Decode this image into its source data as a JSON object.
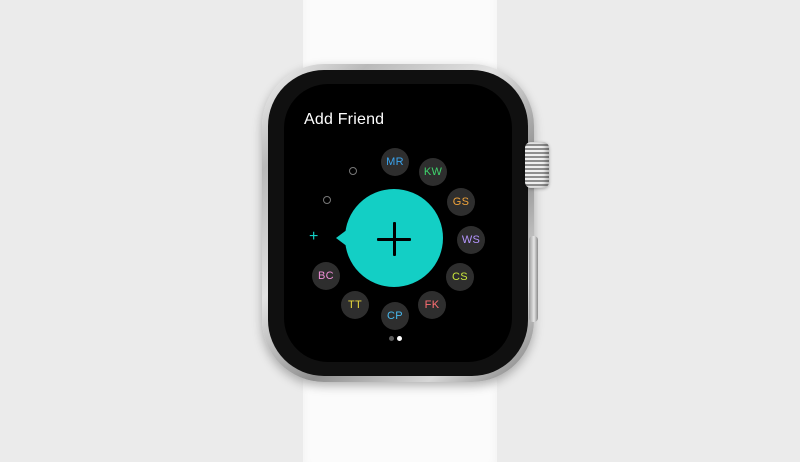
{
  "screen": {
    "title": "Add Friend"
  },
  "friends": [
    {
      "initials": "MR",
      "color": "#3aa5f0"
    },
    {
      "initials": "KW",
      "color": "#3fd46c"
    },
    {
      "initials": "GS",
      "color": "#f1a43a"
    },
    {
      "initials": "WS",
      "color": "#b596ff"
    },
    {
      "initials": "CS",
      "color": "#c9e63c"
    },
    {
      "initials": "FK",
      "color": "#ff6f73"
    },
    {
      "initials": "CP",
      "color": "#47b9ef"
    },
    {
      "initials": "TT",
      "color": "#e9d93c"
    },
    {
      "initials": "BC",
      "color": "#ef8fd7"
    }
  ],
  "add_button": {
    "icon": "plus-icon",
    "color": "#13cfc5"
  },
  "small_add": {
    "icon": "plus-icon",
    "symbol": "+"
  },
  "page_indicator": {
    "pages": 2,
    "current": 2
  },
  "colors": {
    "background": "#ebebeb",
    "band": "#fbfbfb",
    "screen": "#000000",
    "accent": "#13cfc5"
  }
}
